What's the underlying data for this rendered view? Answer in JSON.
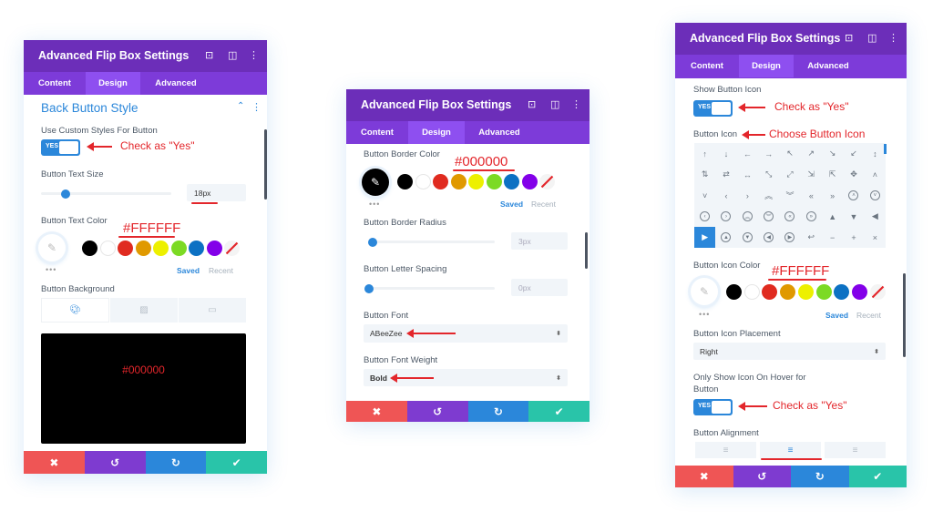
{
  "colors": {
    "header": "#6c2eb9",
    "tabs": "#7d3bd9",
    "accent": "#2b87da",
    "annotation": "#e3262b",
    "cancel": "#ef5555",
    "undo": "#7e3bd0",
    "redo": "#2b87da",
    "save": "#29c4a9"
  },
  "panel_title": "Advanced Flip Box Settings",
  "tabs": [
    "Content",
    "Design",
    "Advanced"
  ],
  "footer_icons": [
    "close-icon",
    "undo-icon",
    "redo-icon",
    "check-icon"
  ],
  "footer_glyphs": [
    "✖",
    "↺",
    "↻",
    "✔"
  ],
  "swatches": [
    "#000000",
    "#ffffff",
    "#e02b20",
    "#e09900",
    "#edf000",
    "#7cda24",
    "#0c71c3",
    "#8300e9",
    "none"
  ],
  "palette": {
    "dots": "•••",
    "saved": "Saved",
    "recent": "Recent"
  },
  "toggle_yes": "YES",
  "panel1": {
    "section": "Back Button Style",
    "custom_styles_label": "Use Custom Styles For Button",
    "note_yes": "Check as \"Yes\"",
    "text_size_label": "Button Text Size",
    "text_size_value": "18px",
    "text_color_label": "Button Text Color",
    "text_color_note": "#FFFFFF",
    "background_label": "Button Background",
    "background_note": "#000000"
  },
  "panel2": {
    "border_color_label": "Button Border Color",
    "border_color_note": "#000000",
    "border_radius_label": "Button Border Radius",
    "border_radius_value": "3px",
    "letter_spacing_label": "Button Letter Spacing",
    "letter_spacing_value": "0px",
    "font_label": "Button Font",
    "font_value": "ABeeZee",
    "font_weight_label": "Button Font Weight",
    "font_weight_value": "Bold"
  },
  "panel3": {
    "show_icon_label": "Show Button Icon",
    "note_yes": "Check as \"Yes\"",
    "icon_label": "Button Icon",
    "icon_note": "Choose Button Icon",
    "icons": [
      {
        "g": "↑"
      },
      {
        "g": "↓"
      },
      {
        "g": "←"
      },
      {
        "g": "→"
      },
      {
        "g": "↖"
      },
      {
        "g": "↗"
      },
      {
        "g": "↘"
      },
      {
        "g": "↙"
      },
      {
        "g": "↕"
      },
      {
        "g": "⇅"
      },
      {
        "g": "⇄"
      },
      {
        "g": "↔"
      },
      {
        "g": "⤡"
      },
      {
        "g": "⤢"
      },
      {
        "g": "⇲"
      },
      {
        "g": "⇱"
      },
      {
        "g": "✥"
      },
      {
        "g": "˄"
      },
      {
        "g": "˅"
      },
      {
        "g": "‹"
      },
      {
        "g": "›"
      },
      {
        "g": "︽"
      },
      {
        "g": "︾"
      },
      {
        "g": "«"
      },
      {
        "g": "»"
      },
      {
        "g": "˄",
        "c": true
      },
      {
        "g": "˅",
        "c": true
      },
      {
        "g": "‹",
        "c": true
      },
      {
        "g": "›",
        "c": true
      },
      {
        "g": "︽",
        "c": true
      },
      {
        "g": "︾",
        "c": true
      },
      {
        "g": "«",
        "c": true
      },
      {
        "g": "»",
        "c": true
      },
      {
        "g": "▲"
      },
      {
        "g": "▼"
      },
      {
        "g": "◀"
      },
      {
        "g": "▶",
        "on": true
      },
      {
        "g": "▲",
        "c": true
      },
      {
        "g": "▼",
        "c": true
      },
      {
        "g": "◀",
        "c": true
      },
      {
        "g": "▶",
        "c": true
      },
      {
        "g": "↩"
      },
      {
        "g": "−"
      },
      {
        "g": "+"
      },
      {
        "g": "×"
      }
    ],
    "icon_color_label": "Button Icon Color",
    "icon_color_note": "#FFFFFF",
    "placement_label": "Button Icon Placement",
    "placement_value": "Right",
    "hover_label_1": "Only Show Icon On Hover for",
    "hover_label_2": "Button",
    "alignment_label": "Button Alignment",
    "alignment_selected": "center"
  }
}
